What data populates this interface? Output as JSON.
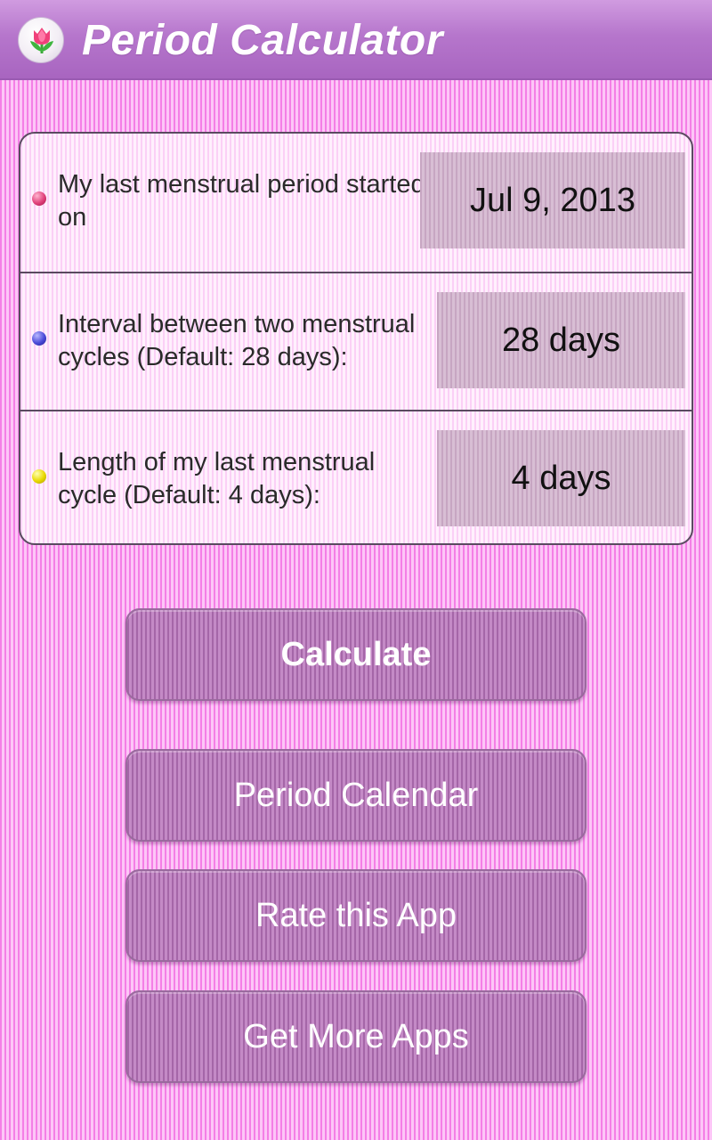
{
  "app_bar": {
    "title": "Period Calculator",
    "icon": "tulip-icon"
  },
  "form": {
    "rows": [
      {
        "label": "My last menstrual period started on",
        "value": "Jul 9, 2013",
        "dot_color": "#e0407a"
      },
      {
        "label": "Interval between two menstrual cycles (Default: 28 days):",
        "value": "28 days",
        "dot_color": "#4a4ad8"
      },
      {
        "label": "Length of my last menstrual cycle (Default: 4 days):",
        "value": "4 days",
        "dot_color": "#e8d800"
      }
    ]
  },
  "buttons": {
    "calculate": "Calculate",
    "period_calendar": "Period Calendar",
    "rate_app": "Rate this App",
    "more_apps": "Get More Apps"
  },
  "colors": {
    "app_bar": "#b676cc",
    "background": "#f47fe6",
    "button": "#b57ab8"
  }
}
